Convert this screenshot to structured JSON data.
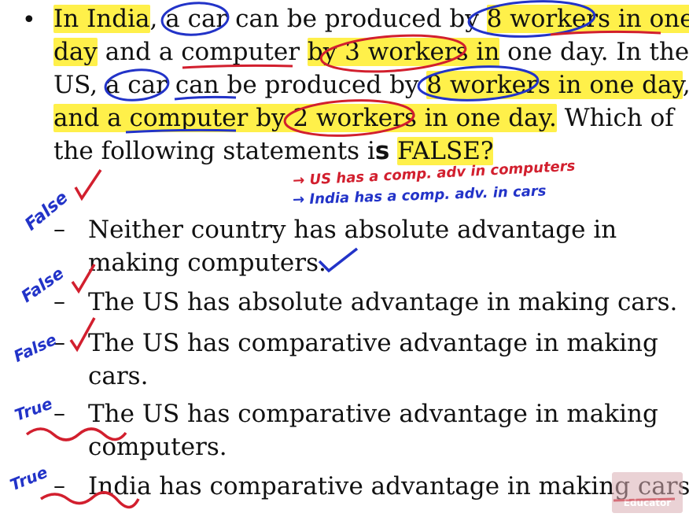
{
  "question": {
    "bullet": "•",
    "line1": {
      "a": "In India",
      "b": ", ",
      "c": "a car",
      "d": " can be produced by ",
      "e": "8 workers in one"
    },
    "line2": {
      "a": "day",
      "b": " and a ",
      "c": "computer",
      "d": " ",
      "e": "by 3 workers in",
      "f": " one day. In the"
    },
    "line3": {
      "a": "US, ",
      "b": "a car",
      "c": " can be produced by ",
      "d": "8 workers in one day",
      "e": ","
    },
    "line4": {
      "a": "and a computer by 2 workers in one day.",
      "b": " Which of"
    },
    "line5": {
      "a": "the following statements i",
      "b": "s",
      "c": " ",
      "d": "FALSE?"
    }
  },
  "annotations": {
    "note1": "→ US has a comp. adv in computers",
    "note2": "→ India has a comp. adv. in cars"
  },
  "options": [
    {
      "dash": "–",
      "line1": "Neither country has absolute advantage in",
      "line2": "making computers.",
      "mark": "False"
    },
    {
      "dash": "–",
      "line1": "The US has absolute advantage in making cars.",
      "mark": "False"
    },
    {
      "dash": "–",
      "line1": "The US has comparative advantage in making",
      "line2": "cars.",
      "mark": "False"
    },
    {
      "dash": "–",
      "line1": "The US has comparative advantage in making",
      "line2": "computers.",
      "mark": "True"
    },
    {
      "dash": "–",
      "line1": "India has comparative advantage in making cars.",
      "mark": "True"
    }
  ],
  "watermark": "Educator"
}
